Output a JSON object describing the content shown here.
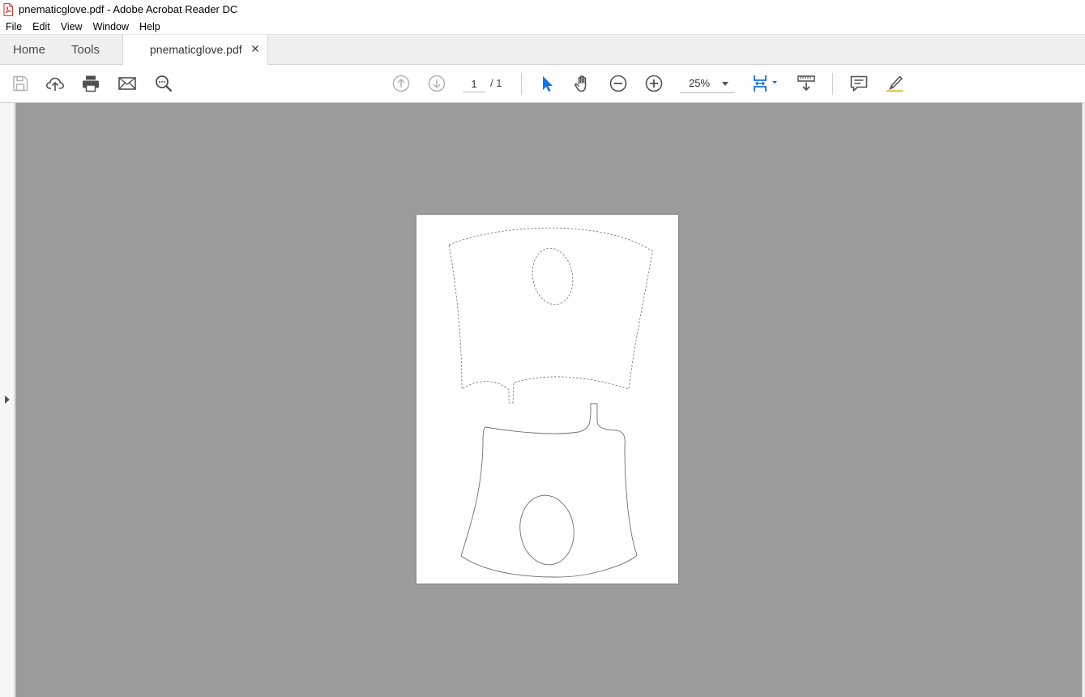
{
  "window": {
    "title": "pnematicglove.pdf - Adobe Acrobat Reader DC"
  },
  "menubar": {
    "items": [
      "File",
      "Edit",
      "View",
      "Window",
      "Help"
    ]
  },
  "tabs": {
    "home": "Home",
    "tools": "Tools",
    "document": "pnematicglove.pdf"
  },
  "toolbar": {
    "page_current": "1",
    "page_total": "/ 1",
    "zoom": "25%"
  },
  "colors": {
    "accent_blue": "#1473e6",
    "viewer_bg": "#9b9b9b",
    "icon_gray": "#505050",
    "disabled_gray": "#b3b3b3"
  },
  "icons": [
    "pdf-file-icon",
    "save-icon",
    "upload-cloud-icon",
    "print-icon",
    "email-icon",
    "zoom-search-icon",
    "page-up-icon",
    "page-down-icon",
    "select-arrow-icon",
    "hand-icon",
    "zoom-out-icon",
    "zoom-in-icon",
    "fit-page-icon",
    "scroll-mode-icon",
    "comment-icon",
    "highlight-pen-icon",
    "close-icon",
    "expand-panel-icon"
  ]
}
